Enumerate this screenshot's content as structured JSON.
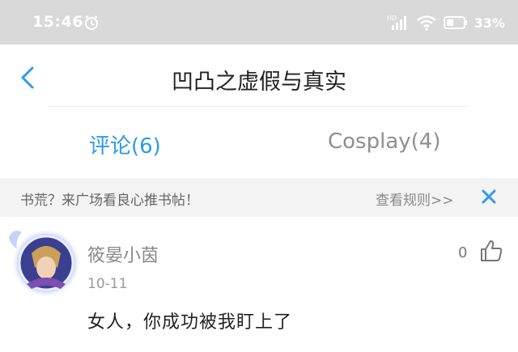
{
  "status_bar": {
    "time": "15:46",
    "battery": "33%",
    "network": "HD",
    "icons": [
      "alarm-icon",
      "signal-icon",
      "wifi-icon",
      "battery-icon"
    ]
  },
  "header": {
    "title": "凹凸之虚假与真实",
    "back_icon": "chevron-left-icon"
  },
  "tabs": [
    {
      "label": "评论(6)",
      "active": true
    },
    {
      "label": "Cosplay(4)",
      "active": false
    }
  ],
  "banner": {
    "text": "书荒？来广场看良心推书帖！",
    "link": "查看规则>>",
    "close_icon": "close-icon"
  },
  "comments": [
    {
      "username": "筱晏小茵",
      "date": "10-11",
      "text": "女人，你成功被我盯上了",
      "likes": "0"
    }
  ],
  "colors": {
    "accent": "#2d9be6",
    "status_bar_bg": "#d9d9d9",
    "banner_bg": "#f3f3f3"
  }
}
